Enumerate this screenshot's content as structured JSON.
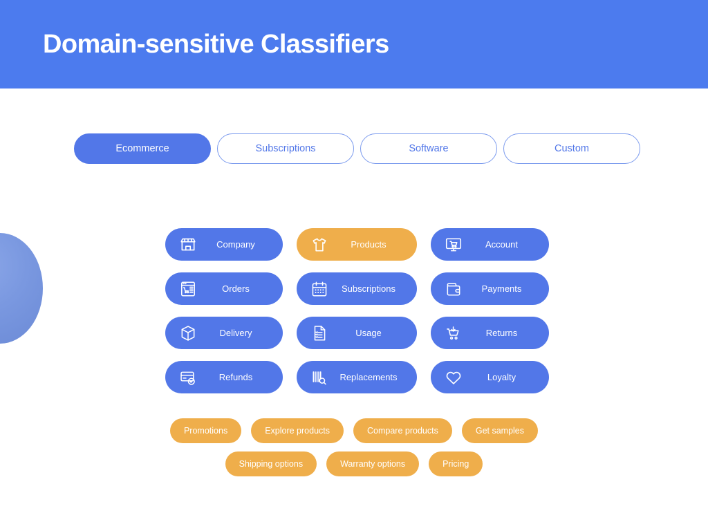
{
  "header": {
    "title": "Domain-sensitive Classifiers",
    "background_color": "#4c7bee",
    "title_color": "#ffffff"
  },
  "theme": {
    "blue": "#5277e8",
    "orange": "#efae4b",
    "page_background": "#ffffff",
    "tab_border": "#7c9bee"
  },
  "tabs": [
    {
      "label": "Ecommerce",
      "state": "active"
    },
    {
      "label": "Subscriptions",
      "state": "idle"
    },
    {
      "label": "Software",
      "state": "idle"
    },
    {
      "label": "Custom",
      "state": "idle"
    }
  ],
  "categories": {
    "rows": [
      [
        {
          "label": "Company",
          "icon": "storefront-icon",
          "color": "blue"
        },
        {
          "label": "Products",
          "icon": "tshirt-icon",
          "color": "orange"
        },
        {
          "label": "Account",
          "icon": "monitor-cart-icon",
          "color": "blue"
        }
      ],
      [
        {
          "label": "Orders",
          "icon": "browser-cart-icon",
          "color": "blue"
        },
        {
          "label": "Subscriptions",
          "icon": "calendar-icon",
          "color": "blue"
        },
        {
          "label": "Payments",
          "icon": "wallet-icon",
          "color": "blue"
        }
      ],
      [
        {
          "label": "Delivery",
          "icon": "box-icon",
          "color": "blue"
        },
        {
          "label": "Usage",
          "icon": "document-list-icon",
          "color": "blue"
        },
        {
          "label": "Returns",
          "icon": "cart-return-icon",
          "color": "blue"
        }
      ],
      [
        {
          "label": "Refunds",
          "icon": "card-check-icon",
          "color": "blue"
        },
        {
          "label": "Replacements",
          "icon": "barcode-search-icon",
          "color": "blue"
        },
        {
          "label": "Loyalty",
          "icon": "heart-icon",
          "color": "blue"
        }
      ]
    ]
  },
  "intents": {
    "rows": [
      [
        {
          "label": "Promotions"
        },
        {
          "label": "Explore products"
        },
        {
          "label": "Compare products"
        },
        {
          "label": "Get samples"
        }
      ],
      [
        {
          "label": "Shipping options"
        },
        {
          "label": "Warranty options"
        },
        {
          "label": "Pricing"
        }
      ]
    ]
  }
}
